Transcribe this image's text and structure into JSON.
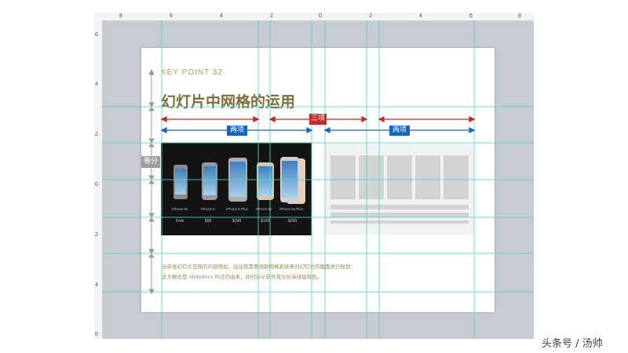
{
  "ruler": {
    "top_ticks": [
      "8",
      "6",
      "4",
      "2",
      "0",
      "2",
      "4",
      "6",
      "8"
    ],
    "left_ticks": [
      "6",
      "4",
      "2",
      "0",
      "2",
      "4",
      "6"
    ]
  },
  "slide": {
    "key_point": "KEY POINT 32",
    "title": "幻灯片中网格的运用",
    "label_equal": "等分",
    "label_two_left": "两项",
    "label_three": "三项",
    "label_two_right": "两项",
    "caption_line1": "当单张幻灯片呈现的内容增加，往往就需要借助网格系统来对幻灯片的版面进行规划：",
    "caption_line2": "这大概也是 Slidedocs 叫法的由来，此时演示软件充分扮演排版角色。"
  },
  "phones": [
    {
      "name": "iPhone 5s",
      "price": "Free"
    },
    {
      "name": "iPhone 6",
      "price": "$99"
    },
    {
      "name": "iPhone 6 Plus",
      "price": "$199"
    },
    {
      "name": "iPhone 6s",
      "price": "$199"
    },
    {
      "name": "iPhone 6s Plus",
      "price": "$299"
    }
  ],
  "watermark": "头条号 / 汤帅",
  "colors": {
    "canvas": "#c7ccd2",
    "guide": "#4fd8c4",
    "red_arrow": "#c62828",
    "blue_arrow": "#1565c0",
    "title": "#7d6d3a",
    "placeholder": "#d3d3d3"
  }
}
